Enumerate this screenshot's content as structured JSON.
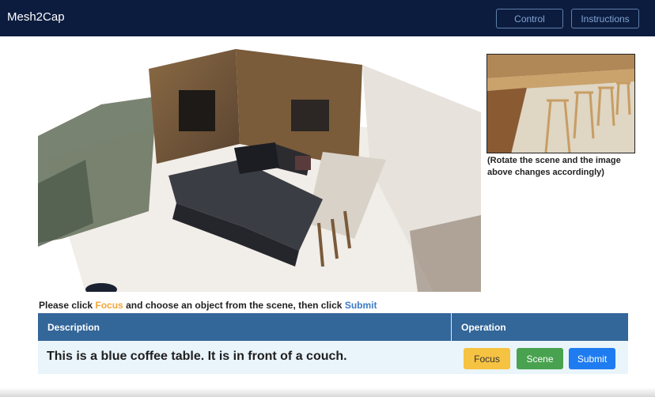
{
  "app": {
    "title": "Mesh2Cap"
  },
  "nav": {
    "control_label": "Control",
    "instructions_label": "Instructions"
  },
  "thumbnail": {
    "caption": "(Rotate the scene and the image above changes accordingly)"
  },
  "instruction": {
    "prefix": "Please click ",
    "focus_word": "Focus",
    "middle": " and choose an object from the scene, then click ",
    "submit_word": "Submit"
  },
  "table": {
    "headers": {
      "description": "Description",
      "operation": "Operation"
    },
    "row": {
      "description": "This is a blue coffee table. It is in front of a couch.",
      "buttons": {
        "focus": "Focus",
        "scene": "Scene",
        "submit": "Submit"
      }
    }
  },
  "colors": {
    "navbar": "#0c1c3f",
    "table_header": "#336699",
    "focus_accent": "#f0a73a",
    "submit_accent": "#3b7bc7",
    "focus_button": "#f6c242",
    "scene_button": "#48a24f",
    "submit_button": "#1f7cf0"
  }
}
